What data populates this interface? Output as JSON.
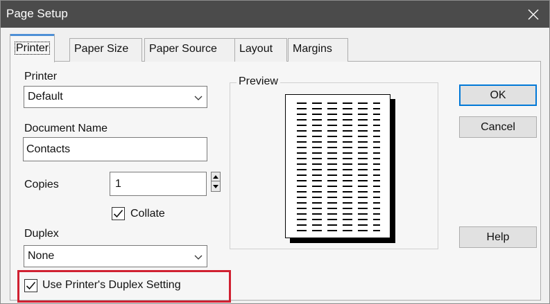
{
  "window": {
    "title": "Page Setup",
    "close_icon": "close-icon"
  },
  "tabs": [
    {
      "label": "Printer",
      "active": true
    },
    {
      "label": "Paper Size"
    },
    {
      "label": "Paper Source"
    },
    {
      "label": "Layout"
    },
    {
      "label": "Margins"
    }
  ],
  "printer": {
    "label": "Printer",
    "value": "Default"
  },
  "document": {
    "label": "Document Name",
    "value": "Contacts"
  },
  "copies": {
    "label": "Copies",
    "value": "1"
  },
  "collate": {
    "label": "Collate",
    "checked": true
  },
  "duplex": {
    "label": "Duplex",
    "value": "None"
  },
  "use_duplex": {
    "label": "Use Printer's Duplex Setting",
    "checked": true
  },
  "preview": {
    "label": "Preview"
  },
  "buttons": {
    "ok": "OK",
    "cancel": "Cancel",
    "help": "Help"
  },
  "colors": {
    "highlight": "#d02031",
    "accent": "#0078d7",
    "titlebar": "#4b4b4b"
  }
}
